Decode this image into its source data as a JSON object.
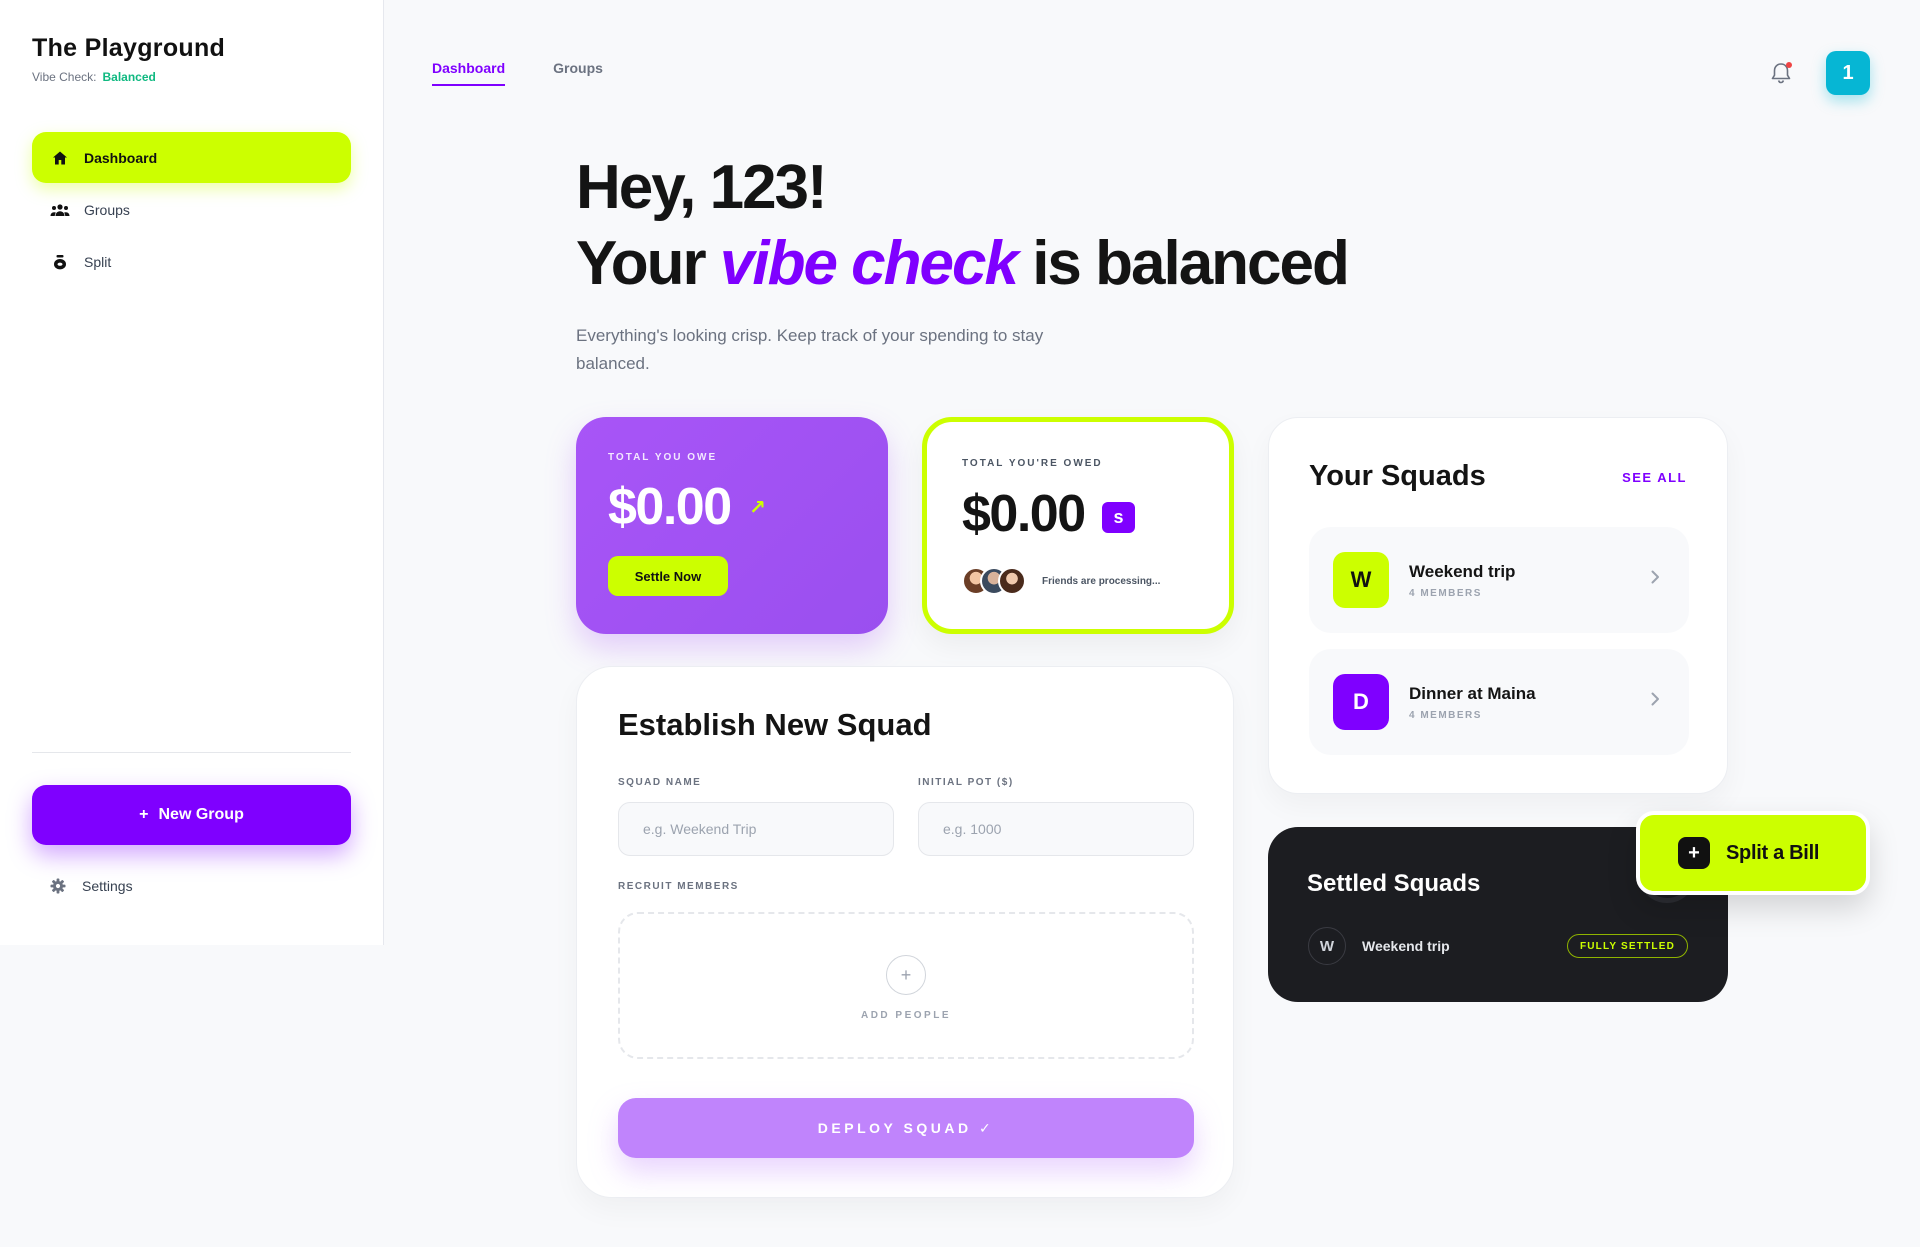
{
  "brand": {
    "title": "The Playground",
    "vibe_label": "Vibe Check:",
    "vibe_status": "Balanced"
  },
  "sidebar": {
    "items": [
      {
        "label": "Dashboard",
        "icon": "home-icon",
        "active": true
      },
      {
        "label": "Groups",
        "icon": "users-icon",
        "active": false
      },
      {
        "label": "Split",
        "icon": "money-bag-icon",
        "active": false
      }
    ],
    "new_group": {
      "icon": "+",
      "label": "New Group"
    },
    "settings": "Settings"
  },
  "header": {
    "tabs": [
      {
        "label": "Dashboard",
        "active": true
      },
      {
        "label": "Groups",
        "active": false
      }
    ],
    "avatar_initial": "1"
  },
  "hero": {
    "greeting": "Hey, 123!",
    "line2_before": "Your",
    "line2_accent": "vibe check",
    "line2_after": "is balanced",
    "subtitle": "Everything's looking crisp. Keep track of your spending to stay balanced."
  },
  "owe_card": {
    "label": "TOTAL YOU OWE",
    "amount": "$0.00",
    "trend_icon": "↗",
    "button": "Settle Now"
  },
  "owed_card": {
    "label": "TOTAL YOU'RE OWED",
    "amount": "$0.00",
    "badge": "s",
    "friends_text": "Friends are processing..."
  },
  "squads": {
    "title": "Your Squads",
    "see_all": "SEE ALL",
    "items": [
      {
        "initial": "W",
        "name": "Weekend trip",
        "members": "4 MEMBERS",
        "color": "#ccff00"
      },
      {
        "initial": "D",
        "name": "Dinner at Maina",
        "members": "4 MEMBERS",
        "color": "#7f00ff"
      }
    ]
  },
  "settled": {
    "title": "Settled Squads",
    "items": [
      {
        "initial": "W",
        "name": "Weekend trip",
        "status": "FULLY SETTLED"
      }
    ]
  },
  "split_bill": {
    "icon": "+",
    "label": "Split a Bill"
  },
  "new_squad": {
    "title": "Establish New Squad",
    "name_label": "SQUAD NAME",
    "name_placeholder": "e.g. Weekend Trip",
    "pot_label": "INITIAL POT ($)",
    "pot_placeholder": "e.g. 1000",
    "recruit_label": "RECRUIT MEMBERS",
    "plus": "+",
    "add_people": "ADD PEOPLE",
    "deploy": "DEPLOY SQUAD ✓"
  },
  "colors": {
    "brand": "#7f00ff",
    "lime": "#ccff00",
    "dark": "#1c1d21",
    "balanced": "#10b981",
    "avatar": "#06b6d4"
  }
}
